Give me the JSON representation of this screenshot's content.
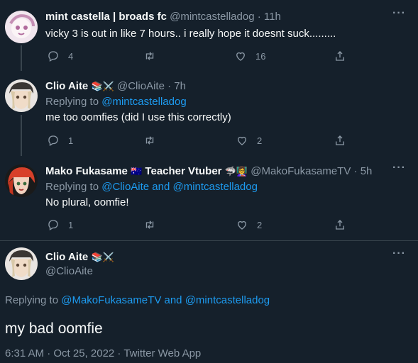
{
  "tweets": [
    {
      "name": "mint castella | broads fc",
      "handle": "@mintcastelladog",
      "time": "11h",
      "reply_prefix": "",
      "reply_to": "",
      "text": "vicky 3 is out in like 7 hours.. i really hope it doesnt suck.........",
      "replies": "4",
      "likes": "16"
    },
    {
      "name": "Clio Aite",
      "handle": "@ClioAite",
      "time": "7h",
      "reply_prefix": "Replying to",
      "reply_to": "@mintcastelladog",
      "text": "me too oomfies (did I use this correctly)",
      "replies": "1",
      "likes": "2"
    },
    {
      "name": "Mako Fukasame",
      "name_suffix": "Teacher Vtuber",
      "handle": "@MakoFukasameTV",
      "time": "5h",
      "reply_prefix": "Replying to",
      "reply_to": "@ClioAite and @mintcastelladog",
      "text": "No plural, oomfie!",
      "replies": "1",
      "likes": "2"
    }
  ],
  "main": {
    "name": "Clio Aite",
    "handle": "@ClioAite",
    "reply_prefix": "Replying to",
    "reply_to_1": "@MakoFukasameTV",
    "reply_and": "and",
    "reply_to_2": "@mintcastelladog",
    "text": "my bad oomfie",
    "meta": "6:31 AM · Oct 25, 2022 · Twitter Web App"
  },
  "separator": "·",
  "colors": {
    "background": "#15202b",
    "accent": "#1d9bf0",
    "muted": "#8b98a5"
  }
}
